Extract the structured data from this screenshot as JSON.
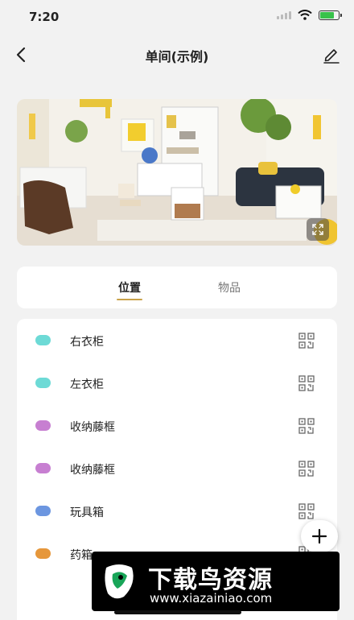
{
  "status_bar": {
    "time": "7:20",
    "icons": [
      "cellular-signal-icon",
      "wifi-icon",
      "battery-charging-icon"
    ]
  },
  "header": {
    "title": "单间(示例)",
    "icons": [
      "back-arrow-icon",
      "edit-pencil-icon"
    ]
  },
  "photo": {
    "icon": "expand-icon"
  },
  "tabs": [
    {
      "label": "位置",
      "active": true
    },
    {
      "label": "物品",
      "active": false
    }
  ],
  "locations": [
    {
      "name": "右衣柜",
      "color": "#6ddad6"
    },
    {
      "name": "左衣柜",
      "color": "#6ddad6"
    },
    {
      "name": "收纳藤框",
      "color": "#c77fd1"
    },
    {
      "name": "收纳藤框",
      "color": "#c77fd1"
    },
    {
      "name": "玩具箱",
      "color": "#6c96e0"
    },
    {
      "name": "药箱",
      "color": "#e6973b"
    }
  ],
  "fab": {
    "icon": "plus-icon"
  },
  "watermark": {
    "brand": "下载鸟资源",
    "url": "www.xiazainiao.com"
  }
}
